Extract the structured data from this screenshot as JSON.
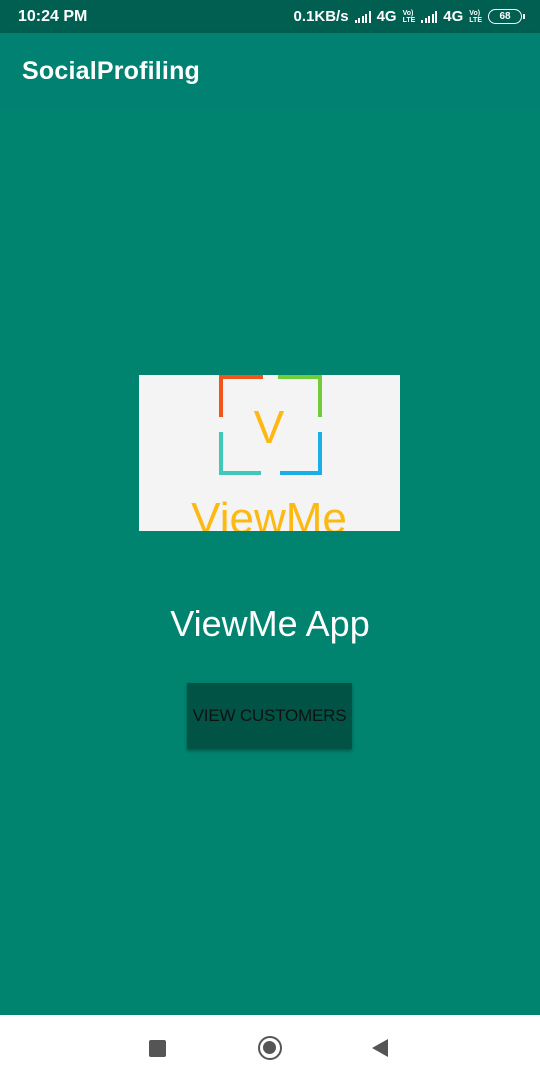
{
  "status_bar": {
    "time": "10:24 PM",
    "speed": "0.1KB/s",
    "network1": "4G",
    "network2": "4G",
    "volte_top": "Vo)",
    "volte_bottom": "LTE",
    "battery": "68"
  },
  "app_bar": {
    "title": "SocialProfiling"
  },
  "main": {
    "logo_text": "ViewMe",
    "logo_letter": "V",
    "app_name": "ViewMe App",
    "button_label": "VIEW CUSTOMERS"
  },
  "colors": {
    "primary": "#008171",
    "primary_dark": "#005f50",
    "background": "#00836f",
    "button": "#005345",
    "logo_orange": "#f1551c",
    "logo_green": "#71cc3a",
    "logo_teal": "#3ec9b8",
    "logo_blue": "#1aaee8",
    "logo_yellow": "#fdb913"
  },
  "nav_bar": {
    "recents_icon": "square-icon",
    "home_icon": "circle-icon",
    "back_icon": "triangle-back-icon"
  }
}
